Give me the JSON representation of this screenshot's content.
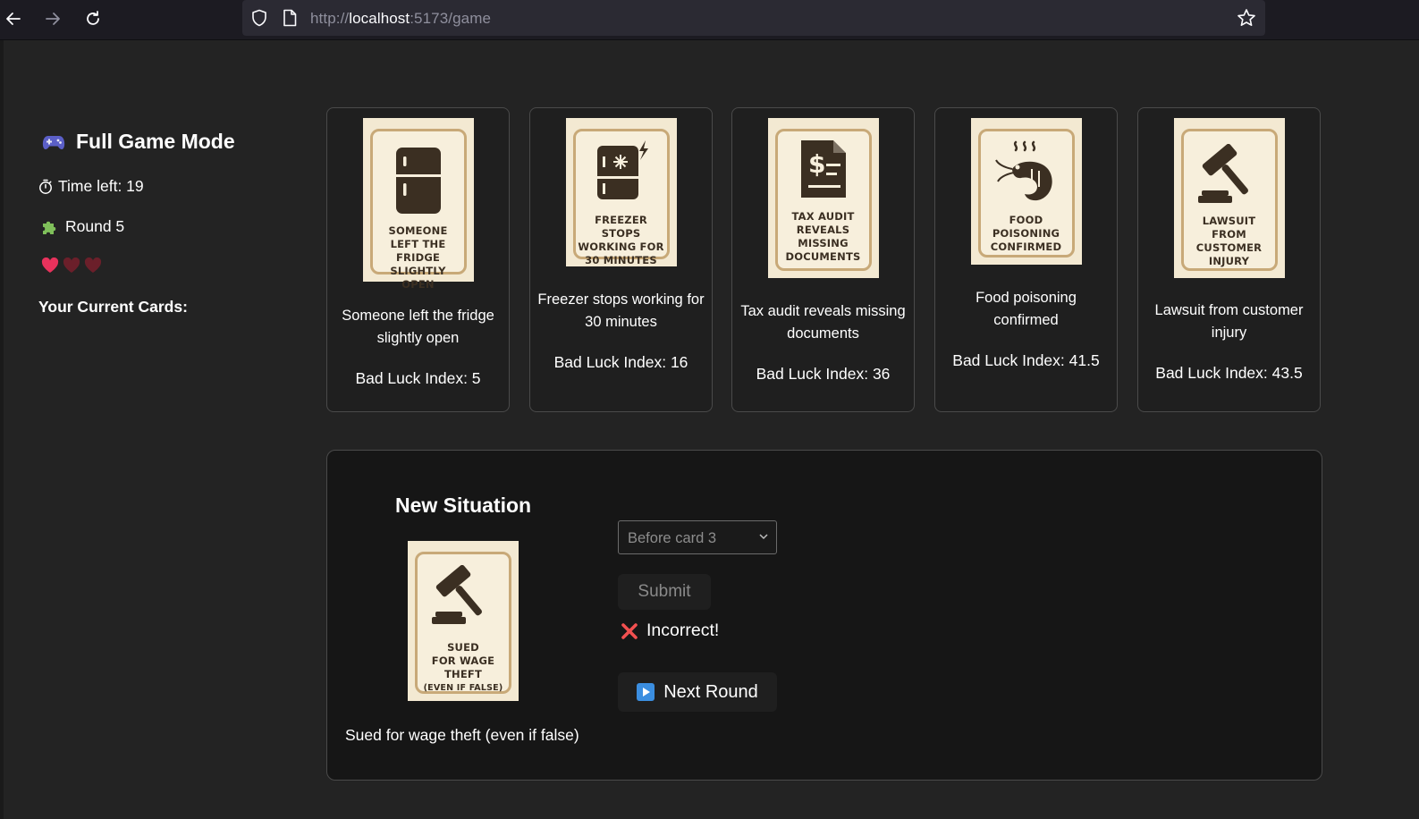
{
  "browser": {
    "url_prefix": "http://",
    "url_host": "localhost",
    "url_rest": ":5173/game"
  },
  "sidebar": {
    "mode_title": "Full Game Mode",
    "time_left": "Time left: 19",
    "round": "Round 5",
    "hearts": {
      "total": 3,
      "filled": 1,
      "filled_color": "#e8325c",
      "empty_color": "#6b1f2a"
    },
    "cards_label": "Your Current Cards:"
  },
  "cards": [
    {
      "poster_lines": [
        "SOMEONE",
        "LEFT THE",
        "FRIDGE",
        "SLIGHTLY OPEN"
      ],
      "icon": "fridge-icon",
      "caption": "Someone left the fridge slightly open",
      "index_label": "Bad Luck Index: 5"
    },
    {
      "poster_lines": [
        "FREEZER STOPS",
        "WORKING FOR",
        "30 MINUTES"
      ],
      "icon": "freezer-icon",
      "caption": "Freezer stops working for 30 minutes",
      "index_label": "Bad Luck Index: 16"
    },
    {
      "poster_lines": [
        "TAX AUDIT",
        "REVEALS",
        "MISSING",
        "DOCUMENTS"
      ],
      "icon": "tax-document-icon",
      "caption": "Tax audit reveals missing documents",
      "index_label": "Bad Luck Index: 36"
    },
    {
      "poster_lines": [
        "FOOD",
        "POISONING",
        "CONFIRMED"
      ],
      "icon": "shrimp-icon",
      "caption": "Food poisoning confirmed",
      "index_label": "Bad Luck Index: 41.5"
    },
    {
      "poster_lines": [
        "LAWSUIT",
        "FROM",
        "CUSTOMER",
        "INJURY"
      ],
      "icon": "gavel-icon",
      "caption": "Lawsuit from customer injury",
      "index_label": "Bad Luck Index: 43.5"
    }
  ],
  "situation": {
    "title": "New Situation",
    "poster_lines": [
      "SUED",
      "FOR WAGE",
      "THEFT",
      "(EVEN IF FALSE)"
    ],
    "icon": "gavel-icon",
    "caption": "Sued for wage theft (even if false)",
    "select_value": "Before card 3",
    "submit_label": "Submit",
    "result_text": "Incorrect!",
    "next_label": "Next Round"
  }
}
